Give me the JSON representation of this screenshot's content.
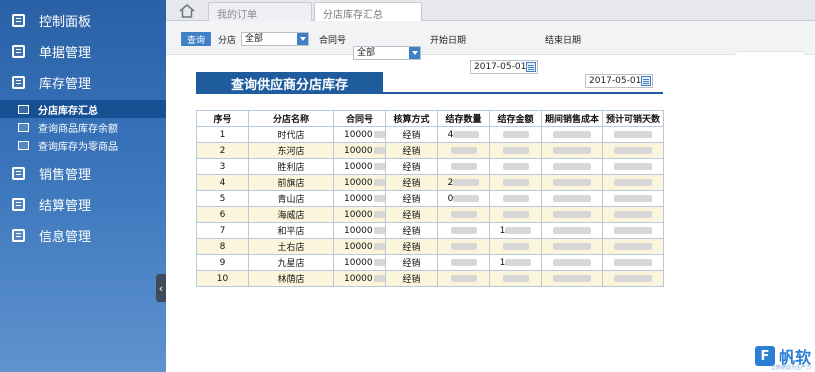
{
  "sidebar": {
    "menu": [
      {
        "label": "控制面板",
        "icon": "dashboard-icon"
      },
      {
        "label": "单据管理",
        "icon": "document-icon"
      },
      {
        "label": "库存管理",
        "icon": "inventory-icon"
      }
    ],
    "submenu": [
      {
        "label": "分店库存汇总",
        "active": true
      },
      {
        "label": "查询商品库存余额",
        "active": false
      },
      {
        "label": "查询库存为零商品",
        "active": false
      }
    ],
    "menu_after": [
      {
        "label": "销售管理",
        "icon": "sales-icon"
      },
      {
        "label": "结算管理",
        "icon": "settlement-icon"
      },
      {
        "label": "信息管理",
        "icon": "info-icon"
      }
    ],
    "collapse_glyph": "‹"
  },
  "tabs": [
    {
      "label": "我的订单",
      "active": false
    },
    {
      "label": "分店库存汇总",
      "active": true
    }
  ],
  "filter": {
    "query_label": "查询",
    "store_label": "分店",
    "store_value": "全部",
    "contract_label": "合同号",
    "contract_value": "全部",
    "start_label": "开始日期",
    "start_value": "2017-05-01",
    "end_label": "结束日期",
    "end_value": "2017-05-01"
  },
  "report": {
    "title": "查询供应商分店库存",
    "columns": [
      "序号",
      "分店名称",
      "合同号",
      "核算方式",
      "结存数量",
      "结存金额",
      "期间销售成本",
      "预计可销天数"
    ],
    "rows": [
      {
        "no": "1",
        "store": "时代店",
        "contract": "10000",
        "method": "经销",
        "qty": "4",
        "amount": "",
        "cost": "",
        "days": ""
      },
      {
        "no": "2",
        "store": "东河店",
        "contract": "10000",
        "method": "经销",
        "qty": "",
        "amount": "",
        "cost": "",
        "days": ""
      },
      {
        "no": "3",
        "store": "胜利店",
        "contract": "10000",
        "method": "经销",
        "qty": "",
        "amount": "",
        "cost": "",
        "days": ""
      },
      {
        "no": "4",
        "store": "前旗店",
        "contract": "10000",
        "method": "经销",
        "qty": "2",
        "amount": "",
        "cost": "",
        "days": ""
      },
      {
        "no": "5",
        "store": "青山店",
        "contract": "10000",
        "method": "经销",
        "qty": "0",
        "amount": "",
        "cost": "",
        "days": ""
      },
      {
        "no": "6",
        "store": "海威店",
        "contract": "10000",
        "method": "经销",
        "qty": "",
        "amount": "",
        "cost": "",
        "days": ""
      },
      {
        "no": "7",
        "store": "和平店",
        "contract": "10000",
        "method": "经销",
        "qty": "",
        "amount": "1",
        "cost": "",
        "days": ""
      },
      {
        "no": "8",
        "store": "土右店",
        "contract": "10000",
        "method": "经销",
        "qty": "",
        "amount": "",
        "cost": "",
        "days": ""
      },
      {
        "no": "9",
        "store": "九星店",
        "contract": "10000",
        "method": "经销",
        "qty": "",
        "amount": "1",
        "cost": "",
        "days": ""
      },
      {
        "no": "10",
        "store": "林荫店",
        "contract": "10000",
        "method": "经销",
        "qty": "",
        "amount": "",
        "cost": "",
        "days": ""
      }
    ]
  },
  "logo": {
    "mark": "F",
    "name": "帆软",
    "slogan": "让数据成为生产力"
  }
}
